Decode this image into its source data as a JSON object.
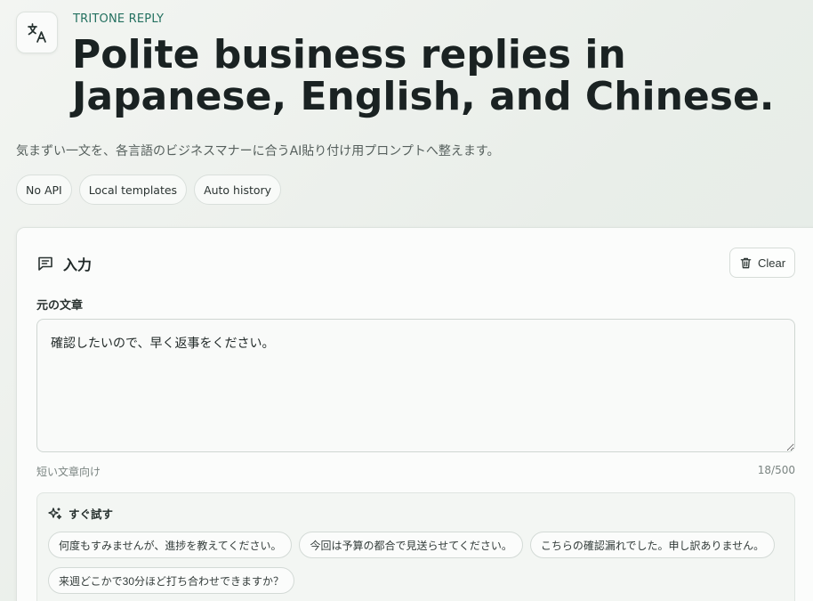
{
  "header": {
    "logo_icon": "translate-icon",
    "eyebrow": "TRITONE REPLY",
    "title": "Polite business replies in Japanese, English, and Chinese.",
    "subtitle": "気まずい一文を、各言語のビジネスマナーに合うAI貼り付け用プロンプトへ整えます。",
    "badges": [
      "No API",
      "Local templates",
      "Auto history"
    ]
  },
  "input_panel": {
    "icon": "message-icon",
    "title": "入力",
    "clear_label": "Clear",
    "clear_icon": "trash-icon",
    "field_label": "元の文章",
    "field_value": "確認したいので、早く返事をください。",
    "hint": "短い文章向け",
    "char_count": "18/500"
  },
  "quick_try": {
    "icon": "sparkle-icon",
    "title": "すぐ試す",
    "samples": [
      "何度もすみませんが、進捗を教えてください。",
      "今回は予算の都合で見送らせてください。",
      "こちらの確認漏れでした。申し訳ありません。",
      "来週どこかで30分ほど打ち合わせできますか？"
    ]
  },
  "colors": {
    "accent": "#23705f",
    "text": "#1a2222",
    "muted": "#56605d"
  }
}
